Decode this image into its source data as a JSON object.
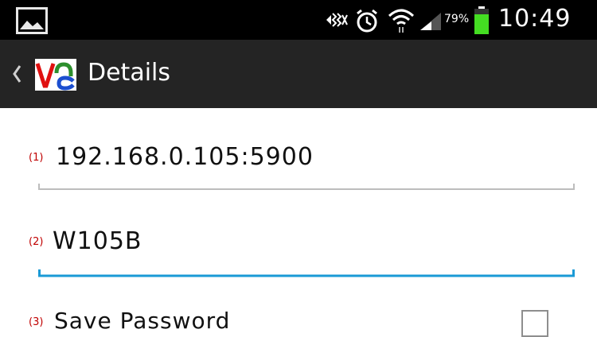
{
  "status_bar": {
    "icons": [
      "image-notification-icon",
      "silent-mode-icon",
      "alarm-clock-icon",
      "wifi-icon",
      "signal-icon",
      "battery-icon"
    ],
    "battery_percent": "79%",
    "time": "10:49"
  },
  "action_bar": {
    "title": "Details",
    "logo_icon": "vnc-app-logo"
  },
  "form": {
    "fields": [
      {
        "num": "(1)",
        "value": "192.168.0.105:5900",
        "focused": false
      },
      {
        "num": "(2)",
        "value": "W105B",
        "focused": true
      }
    ],
    "save_password": {
      "num": "(3)",
      "label": "Save Password",
      "checked": false
    }
  },
  "colors": {
    "status_bar": "#000000",
    "action_bar": "#242424",
    "accent_focus": "#1a9ad6",
    "number_label": "#c00000",
    "battery_fill": "#44dd22"
  }
}
